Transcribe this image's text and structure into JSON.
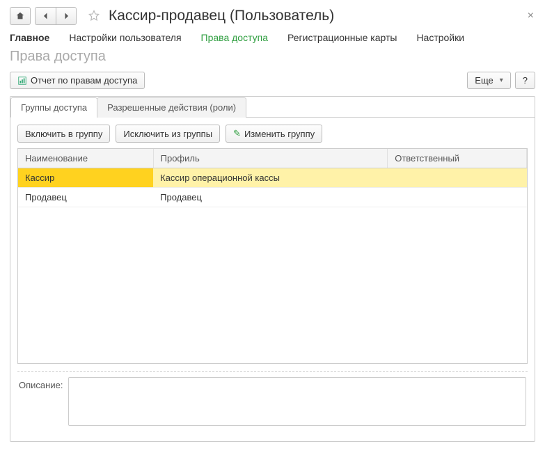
{
  "title": "Кассир-продавец (Пользователь)",
  "topnav": {
    "main": "Главное",
    "user_settings": "Настройки пользователя",
    "access_rights": "Права доступа",
    "reg_cards": "Регистрационные карты",
    "settings": "Настройки"
  },
  "section_title": "Права доступа",
  "toolbar": {
    "report": "Отчет по правам доступа",
    "more": "Еще",
    "help": "?"
  },
  "tabs": {
    "groups": "Группы доступа",
    "roles": "Разрешенные действия (роли)"
  },
  "buttons": {
    "include": "Включить в группу",
    "exclude": "Исключить из группы",
    "edit": "Изменить группу"
  },
  "columns": {
    "name": "Наименование",
    "profile": "Профиль",
    "responsible": "Ответственный"
  },
  "rows": [
    {
      "name": "Кассир",
      "profile": "Кассир операционной кассы",
      "responsible": ""
    },
    {
      "name": "Продавец",
      "profile": "Продавец",
      "responsible": ""
    }
  ],
  "description": {
    "label": "Описание:",
    "value": ""
  }
}
